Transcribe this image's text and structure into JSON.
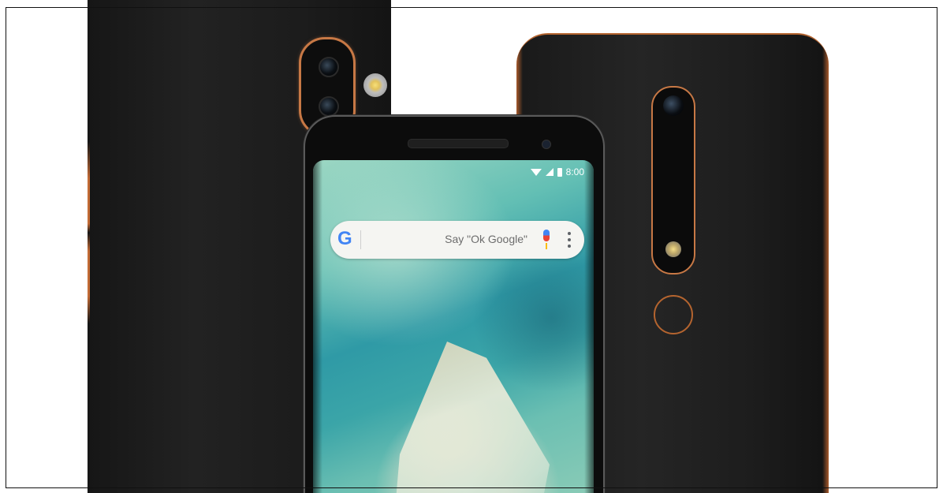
{
  "scene": {
    "background_color": "#ffffff",
    "accent_color": "#c77845"
  },
  "phones": {
    "left": {
      "side": "back"
    },
    "right": {
      "side": "back"
    },
    "center": {
      "side": "front",
      "status_bar": {
        "time": "8:00",
        "icons": [
          "wifi-icon",
          "signal-icon",
          "battery-icon"
        ]
      },
      "search_widget": {
        "logo": "G",
        "placeholder": "Say \"Ok Google\"",
        "icons": [
          "google-logo-icon",
          "mic-icon",
          "more-vert-icon"
        ]
      }
    }
  }
}
